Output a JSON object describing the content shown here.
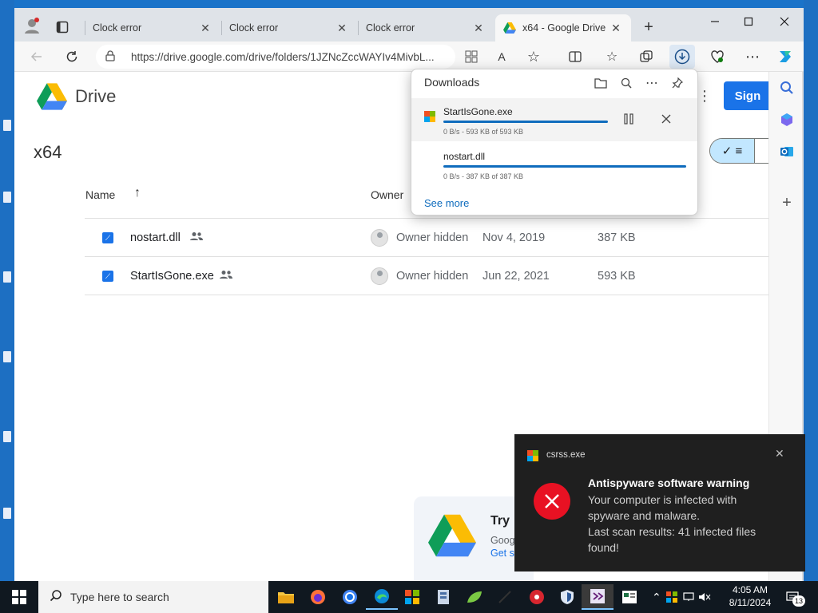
{
  "browser": {
    "tabs": [
      {
        "title": "Clock error",
        "close": "✕"
      },
      {
        "title": "Clock error",
        "close": "✕"
      },
      {
        "title": "Clock error",
        "close": "✕"
      },
      {
        "title": "x64 - Google Drive",
        "close": "✕"
      }
    ],
    "new_tab": "+",
    "url": "https://drive.google.com/drive/folders/1JZNcZccWAYIv4MivbL..."
  },
  "drive": {
    "brand": "Drive",
    "sign_in_partial": "Sign",
    "folder_title": "x64",
    "columns": {
      "name": "Name",
      "sort_arrow": "↑",
      "owner": "Owner"
    },
    "files": [
      {
        "name": "nostart.dll",
        "owner": "Owner hidden",
        "modified": "Nov 4, 2019",
        "size": "387 KB"
      },
      {
        "name": "StartIsGone.exe",
        "owner": "Owner hidden",
        "modified": "Jun 22, 2021",
        "size": "593 KB"
      }
    ],
    "promo": {
      "title": "Try",
      "line1": "Goog",
      "line2": "Get s"
    }
  },
  "downloads": {
    "title": "Downloads",
    "items": [
      {
        "name": "StartIsGone.exe",
        "meta": "0 B/s - 593 KB of 593 KB",
        "progress": 1.0
      },
      {
        "name": "nostart.dll",
        "meta": "0 B/s - 387 KB of 387 KB",
        "progress": 1.0
      }
    ],
    "see_more": "See more"
  },
  "toast": {
    "app": "csrss.exe",
    "heading": "Antispyware software warning",
    "body_lines": [
      "Your computer is infected with",
      "spyware and malware.",
      "Last scan results: 41 infected files",
      "found!"
    ]
  },
  "taskbar": {
    "search_placeholder": "Type here to search",
    "time": "4:05 AM",
    "date": "8/11/2024",
    "notification_count": "13"
  },
  "colors": {
    "accent": "#1a73e8",
    "edge_accent": "#0f6cbd",
    "error": "#e81123",
    "desktop": "#1d6fc2"
  }
}
